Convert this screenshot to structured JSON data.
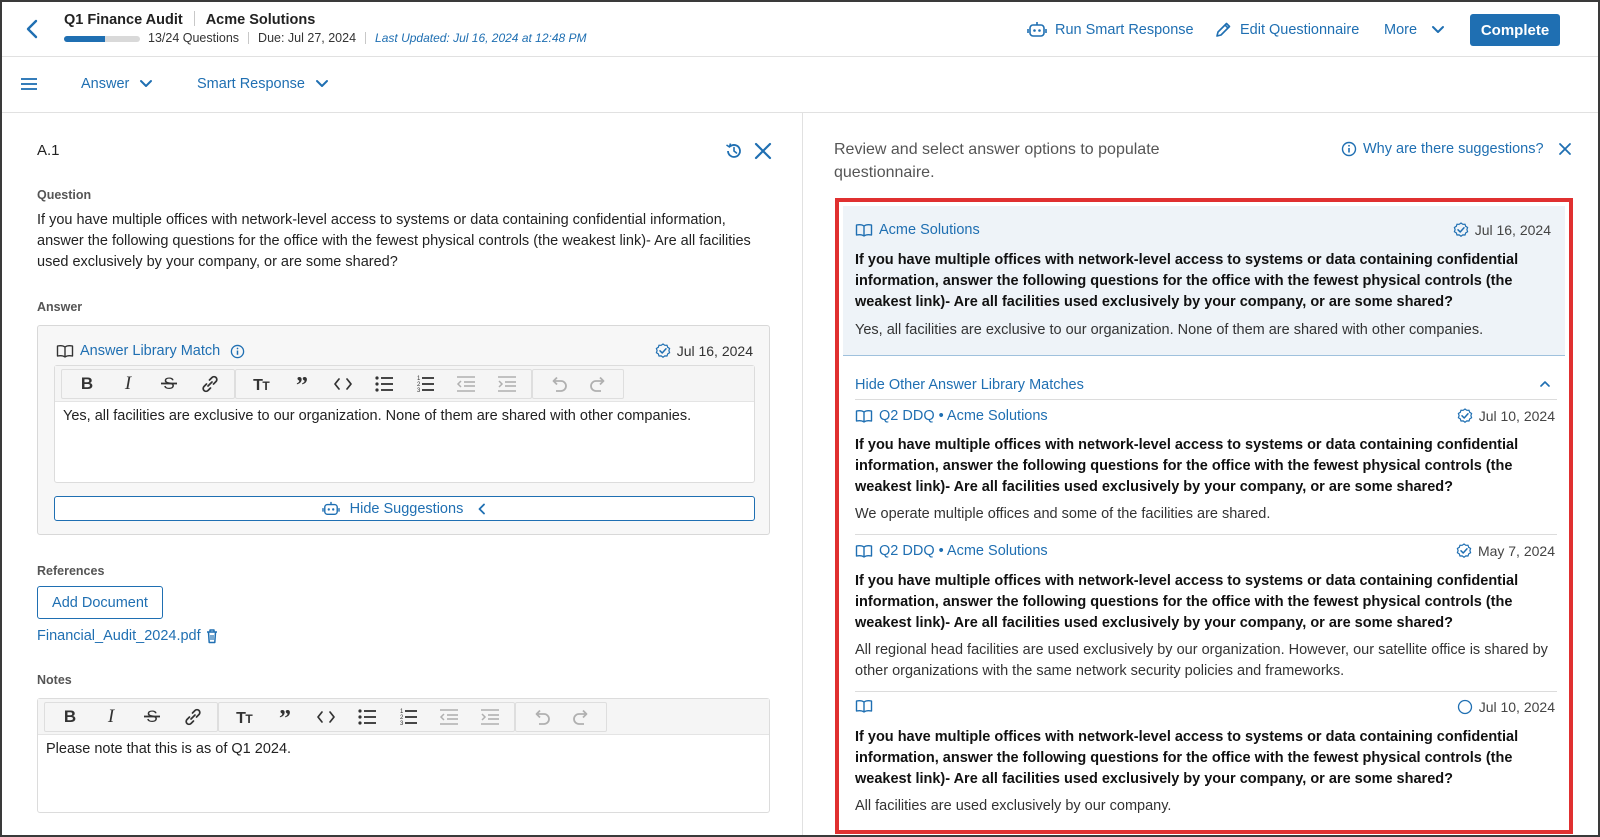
{
  "header": {
    "title": "Q1 Finance Audit",
    "company": "Acme Solutions",
    "progress_fraction": 0.5417,
    "progress_text": "13/24 Questions",
    "due": "Due: Jul 27, 2024",
    "last_updated": "Last Updated: Jul 16, 2024 at 12:48 PM",
    "run_smart_response": "Run Smart Response",
    "edit_questionnaire": "Edit Questionnaire",
    "more": "More",
    "complete": "Complete"
  },
  "toolbar": {
    "answer": "Answer",
    "smart_response": "Smart Response"
  },
  "left": {
    "question_id": "A.1",
    "question_label": "Question",
    "question_text": "If you have multiple offices with network-level access to systems or data containing confidential information, answer the following questions for the office with the fewest physical controls (the weakest link)- Are all facilities used exclusively by your company, or are some shared?",
    "answer_label": "Answer",
    "answer_source": "Answer Library Match",
    "answer_date": "Jul 16, 2024",
    "answer_text": "Yes, all facilities are exclusive to our organization. None of them are shared with other companies.",
    "hide_suggestions": "Hide Suggestions",
    "references_label": "References",
    "add_document": "Add Document",
    "file_name": "Financial_Audit_2024.pdf",
    "notes_label": "Notes",
    "notes_text": "Please note that this is as of Q1 2024."
  },
  "right": {
    "heading": "Review and select answer options to populate questionnaire.",
    "why": "Why are there suggestions?",
    "hide_other": "Hide Other Answer Library Matches",
    "selected": {
      "source": "Acme Solutions",
      "date": "Jul 16, 2024",
      "question": "If you have multiple offices with network-level access to systems or data containing confidential information, answer the following questions for the office with the fewest physical controls (the weakest link)- Are all facilities used exclusively by your company, or are some shared?",
      "answer": "Yes, all facilities are exclusive to our organization. None of them are shared with other companies."
    },
    "matches": [
      {
        "source": "Q2 DDQ • Acme Solutions",
        "date": "Jul 10, 2024",
        "verified": true,
        "question": "If you have multiple offices with network-level access to systems or data containing confidential information, answer the following questions for the office with the fewest physical controls (the weakest link)- Are all facilities used exclusively by your company, or are some shared?",
        "answer": "We operate multiple offices and some of the facilities are shared."
      },
      {
        "source": "Q2 DDQ • Acme Solutions",
        "date": "May 7, 2024",
        "verified": true,
        "question": "If you have multiple offices with network-level access to systems or data containing confidential information, answer the following questions for the office with the fewest physical controls (the weakest link)- Are all facilities used exclusively by your company, or are some shared?",
        "answer": "All regional head facilities are used exclusively by our organization. However, our satellite office is shared by other organizations with the same network security policies and frameworks."
      },
      {
        "source": "",
        "date": "Jul 10, 2024",
        "verified": false,
        "question": "If you have multiple offices with network-level access to systems or data containing confidential information, answer the following questions for the office with the fewest physical controls (the weakest link)- Are all facilities used exclusively by your company, or are some shared?",
        "answer": "All facilities are used exclusively by our company."
      }
    ]
  },
  "colors": {
    "accent": "#1f6fb2",
    "highlight_border": "#e03030",
    "selected_bg": "#eef3f8"
  },
  "icons": [
    "back-chevron-icon",
    "robot-icon",
    "pencil-icon",
    "chevron-down-icon",
    "hamburger-icon",
    "history-icon",
    "close-icon",
    "book-icon",
    "info-icon",
    "verified-check-icon",
    "trash-icon",
    "chevron-left-icon",
    "chevron-up-icon",
    "bold-icon",
    "italic-icon",
    "strikethrough-icon",
    "link-icon",
    "text-size-icon",
    "quote-icon",
    "code-icon",
    "bullet-list-icon",
    "numbered-list-icon",
    "outdent-icon",
    "indent-icon",
    "undo-icon",
    "redo-icon",
    "empty-circle-icon"
  ]
}
